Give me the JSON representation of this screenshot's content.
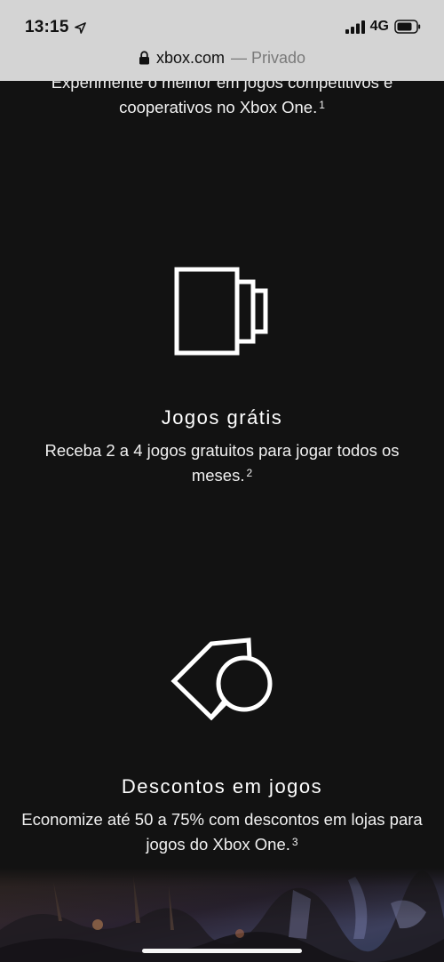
{
  "status_bar": {
    "time": "13:15",
    "network": "4G",
    "icons": [
      "location-arrow-icon",
      "cellular-signal-icon",
      "battery-icon"
    ]
  },
  "browser": {
    "domain": "xbox.com",
    "mode": "— Privado",
    "icon": "lock-icon"
  },
  "intro": {
    "text": "Experimente o melhor em jogos competitivos e cooperativos no Xbox One.",
    "footnote": "1"
  },
  "features": [
    {
      "icon": "game-cases-icon",
      "title": "Jogos grátis",
      "description": "Receba 2 a 4 jogos gratuitos para jogar todos os meses.",
      "footnote": "2"
    },
    {
      "icon": "price-tag-icon",
      "title": "Descontos em jogos",
      "description": "Economize até 50 a 75% com descontos em lojas para jogos do Xbox One.",
      "footnote": "3"
    }
  ],
  "colors": {
    "background": "#121212",
    "chrome": "#d4d4d4",
    "text": "#ffffff",
    "muted": "#7a7a7a"
  }
}
